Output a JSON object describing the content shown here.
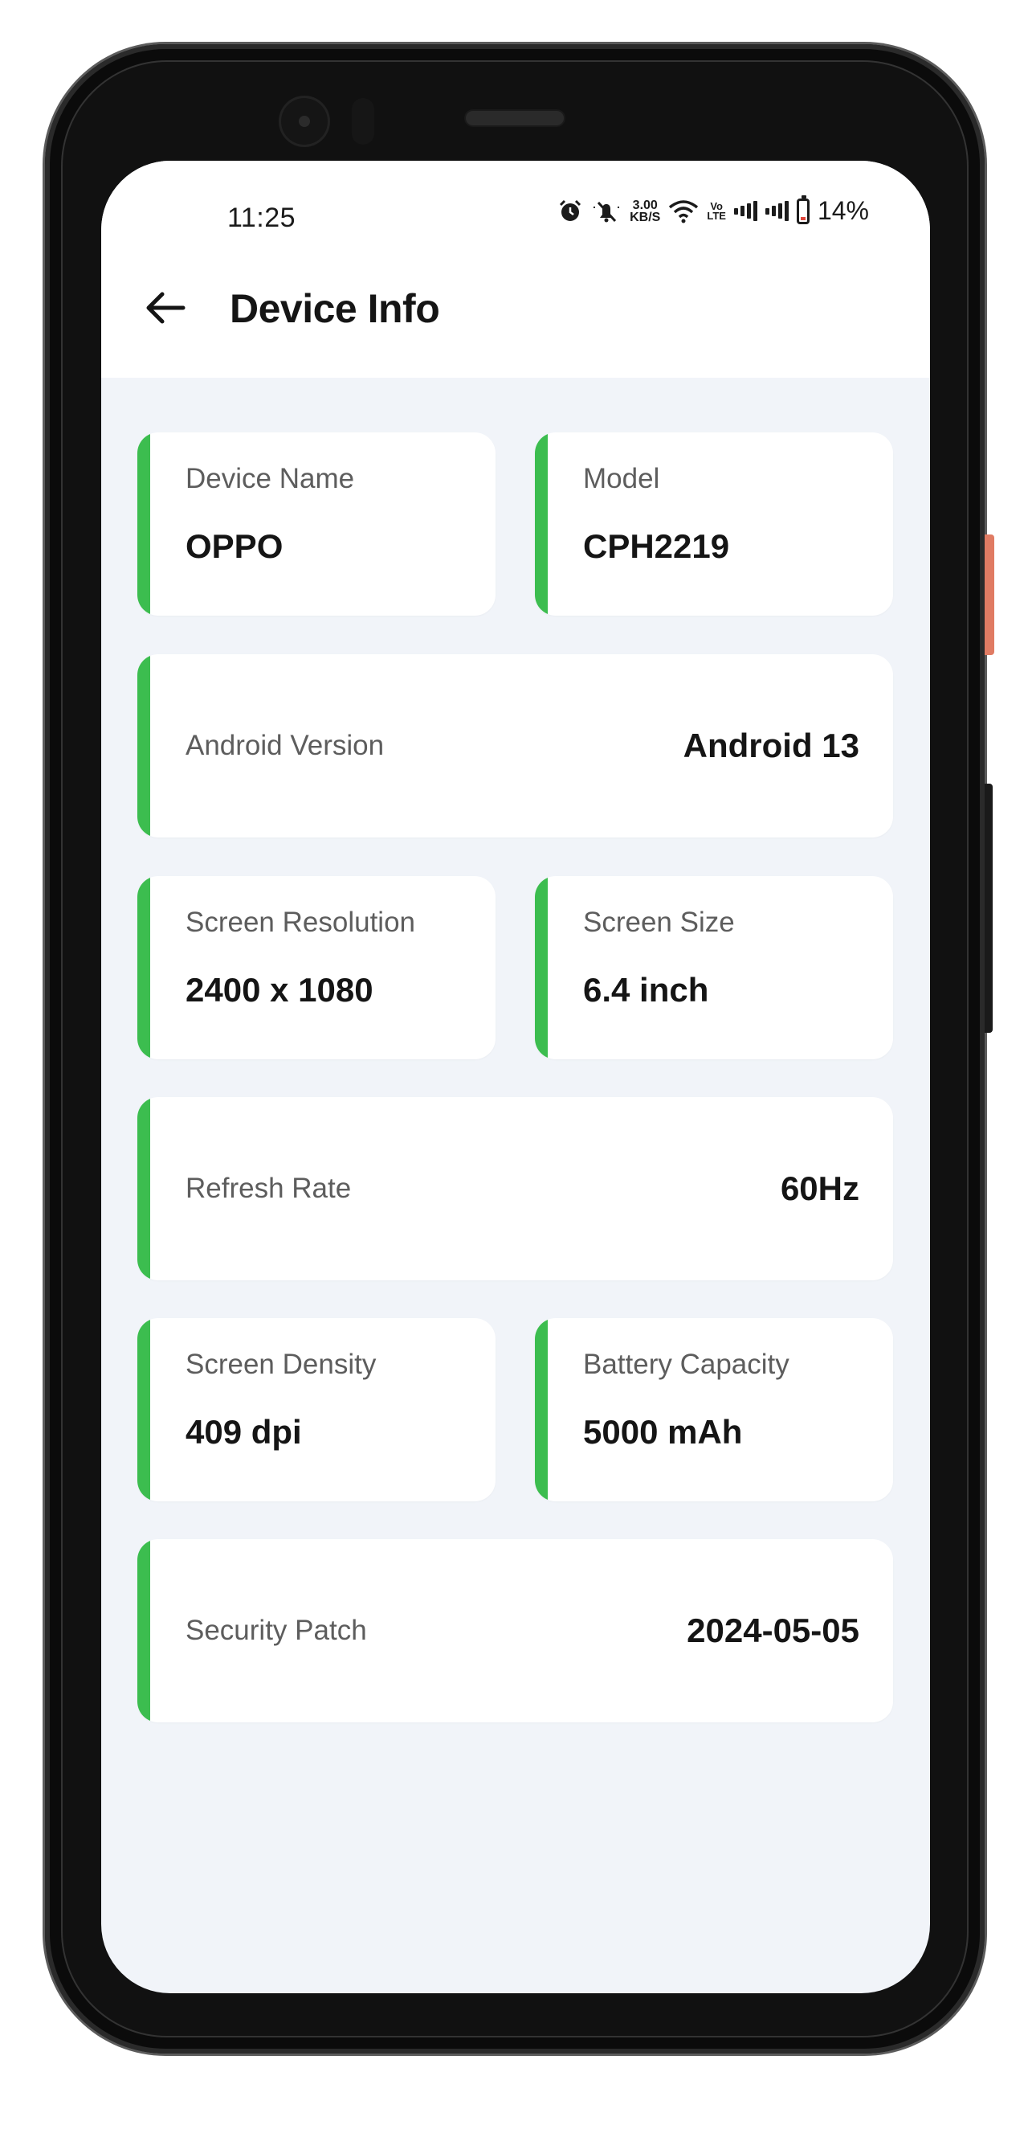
{
  "status_bar": {
    "time": "11:25",
    "net_speed_value": "3.00",
    "net_speed_unit": "KB/S",
    "volte_top": "Vo",
    "volte_bottom": "LTE",
    "battery_percent": "14%"
  },
  "header": {
    "title": "Device Info",
    "back_icon": "arrow-left-icon"
  },
  "info": {
    "device_name": {
      "label": "Device Name",
      "value": "OPPO"
    },
    "model": {
      "label": "Model",
      "value": "CPH2219"
    },
    "android_version": {
      "label": "Android Version",
      "value": "Android 13"
    },
    "screen_resolution": {
      "label": "Screen Resolution",
      "value": "2400 x 1080"
    },
    "screen_size": {
      "label": "Screen Size",
      "value": "6.4 inch"
    },
    "refresh_rate": {
      "label": "Refresh Rate",
      "value": "60Hz"
    },
    "screen_density": {
      "label": "Screen Density",
      "value": "409 dpi"
    },
    "battery_capacity": {
      "label": "Battery Capacity",
      "value": "5000 mAh"
    },
    "security_patch": {
      "label": "Security Patch",
      "value": "2024-05-05"
    }
  },
  "colors": {
    "accent": "#3cbd4f",
    "background": "#f1f4f9",
    "card": "#ffffff"
  }
}
